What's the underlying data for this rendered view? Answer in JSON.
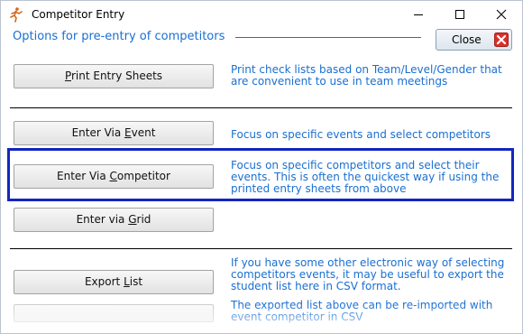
{
  "window": {
    "title": "Competitor Entry"
  },
  "header": {
    "label": "Options for pre-entry of competitors"
  },
  "close_button": {
    "label": "Close"
  },
  "options": [
    {
      "label_pre": "",
      "label_key": "P",
      "label_post": "rint Entry Sheets",
      "desc": "Print check lists based on Team/Level/Gender that are convenient to use in team meetings"
    },
    {
      "label_pre": "Enter Via ",
      "label_key": "E",
      "label_post": "vent",
      "desc": "Focus on specific events and select competitors"
    },
    {
      "label_pre": "Enter Via ",
      "label_key": "C",
      "label_post": "ompetitor",
      "desc": "Focus on specific competitors and select their events.   This is often the quickest way if using the printed entry sheets from above"
    },
    {
      "label_pre": "Enter via ",
      "label_key": "G",
      "label_post": "rid",
      "desc": ""
    },
    {
      "label_pre": "Export ",
      "label_key": "L",
      "label_post": "ist",
      "desc": "If you have some other electronic way of selecting competitors events, it may be useful to export the student list here in CSV format."
    },
    {
      "label_pre": "",
      "label_key": "",
      "label_post": "",
      "desc": "The exported list above can be re-imported with event competitor in CSV"
    }
  ]
}
